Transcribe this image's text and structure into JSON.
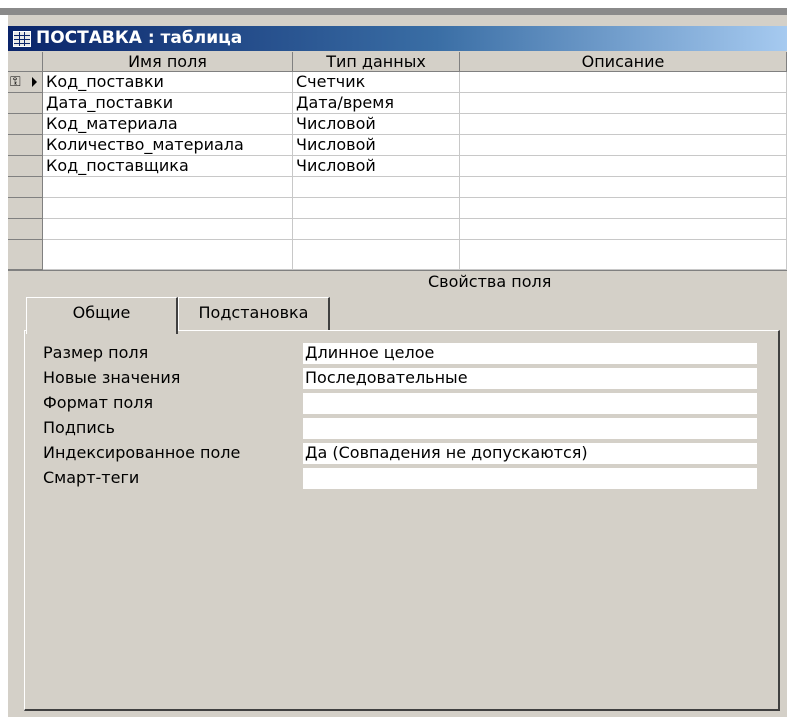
{
  "window": {
    "title": "ПОСТАВКА : таблица",
    "icon": "table-icon"
  },
  "grid": {
    "headers": {
      "field_name": "Имя поля",
      "data_type": "Тип данных",
      "description": "Описание"
    },
    "rows": [
      {
        "name": "Код_поставки",
        "type": "Счетчик",
        "description": "",
        "is_key": true,
        "is_current": true
      },
      {
        "name": "Дата_поставки",
        "type": "Дата/время",
        "description": ""
      },
      {
        "name": "Код_материала",
        "type": "Числовой",
        "description": ""
      },
      {
        "name": "Количество_материала",
        "type": "Числовой",
        "description": ""
      },
      {
        "name": "Код_поставщика",
        "type": "Числовой",
        "description": ""
      }
    ],
    "key_icon": "primary-key-icon",
    "current_row_icon": "record-pointer-icon"
  },
  "field_properties": {
    "header": "Свойства поля",
    "tabs": [
      {
        "label": "Общие",
        "active": true
      },
      {
        "label": "Подстановка",
        "active": false
      }
    ],
    "rows": [
      {
        "label": "Размер поля",
        "value": "Длинное целое"
      },
      {
        "label": "Новые значения",
        "value": "Последовательные"
      },
      {
        "label": "Формат поля",
        "value": ""
      },
      {
        "label": "Подпись",
        "value": ""
      },
      {
        "label": "Индексированное поле",
        "value": "Да (Совпадения не допускаются)"
      },
      {
        "label": "Смарт-теги",
        "value": ""
      }
    ]
  },
  "colors": {
    "title_gradient_start": "#0a246a",
    "title_gradient_end": "#a6caf0",
    "face": "#d4d0c8"
  }
}
